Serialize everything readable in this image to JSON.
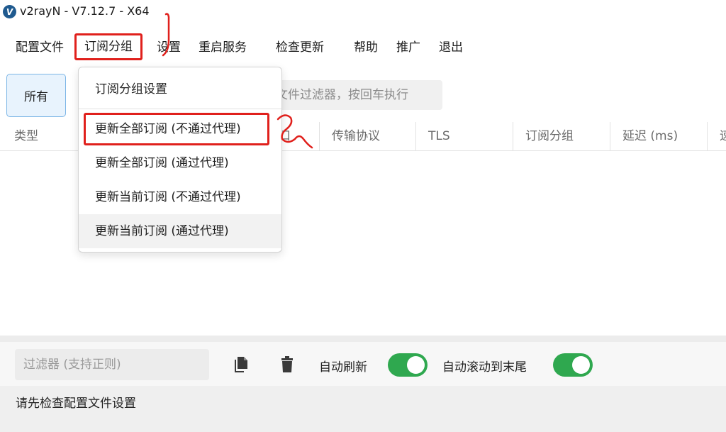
{
  "window": {
    "title": "v2rayN - V7.12.7 - X64",
    "logo_letter": "V"
  },
  "menu": {
    "items": [
      {
        "label": "配置文件"
      },
      {
        "label": "订阅分组"
      },
      {
        "label": "设置"
      },
      {
        "label": "重启服务"
      },
      {
        "label": "检查更新"
      },
      {
        "label": "帮助"
      },
      {
        "label": "推广"
      },
      {
        "label": "退出"
      }
    ]
  },
  "group_tab": {
    "label": "所有"
  },
  "search": {
    "visible_text": "文件过滤器，按回车执行"
  },
  "table": {
    "columns": [
      "类型",
      "口",
      "传输协议",
      "TLS",
      "订阅分组",
      "延迟 (ms)",
      "速"
    ]
  },
  "subscription_menu": {
    "items": [
      {
        "label": "订阅分组设置"
      },
      {
        "label": "更新全部订阅 (不通过代理)"
      },
      {
        "label": "更新全部订阅 (通过代理)"
      },
      {
        "label": "更新当前订阅 (不通过代理)"
      },
      {
        "label": "更新当前订阅 (通过代理)"
      }
    ]
  },
  "bottom": {
    "filter_placeholder": "过滤器 (支持正则)",
    "auto_refresh_label": "自动刷新",
    "auto_refresh_on": true,
    "auto_scroll_label": "自动滚动到末尾",
    "auto_scroll_on": true,
    "log_message": "请先检查配置文件设置"
  },
  "colors": {
    "accent_toggle": "#2fa84f",
    "highlight_red": "#e0201c",
    "tab_border": "#7cb5e6"
  }
}
